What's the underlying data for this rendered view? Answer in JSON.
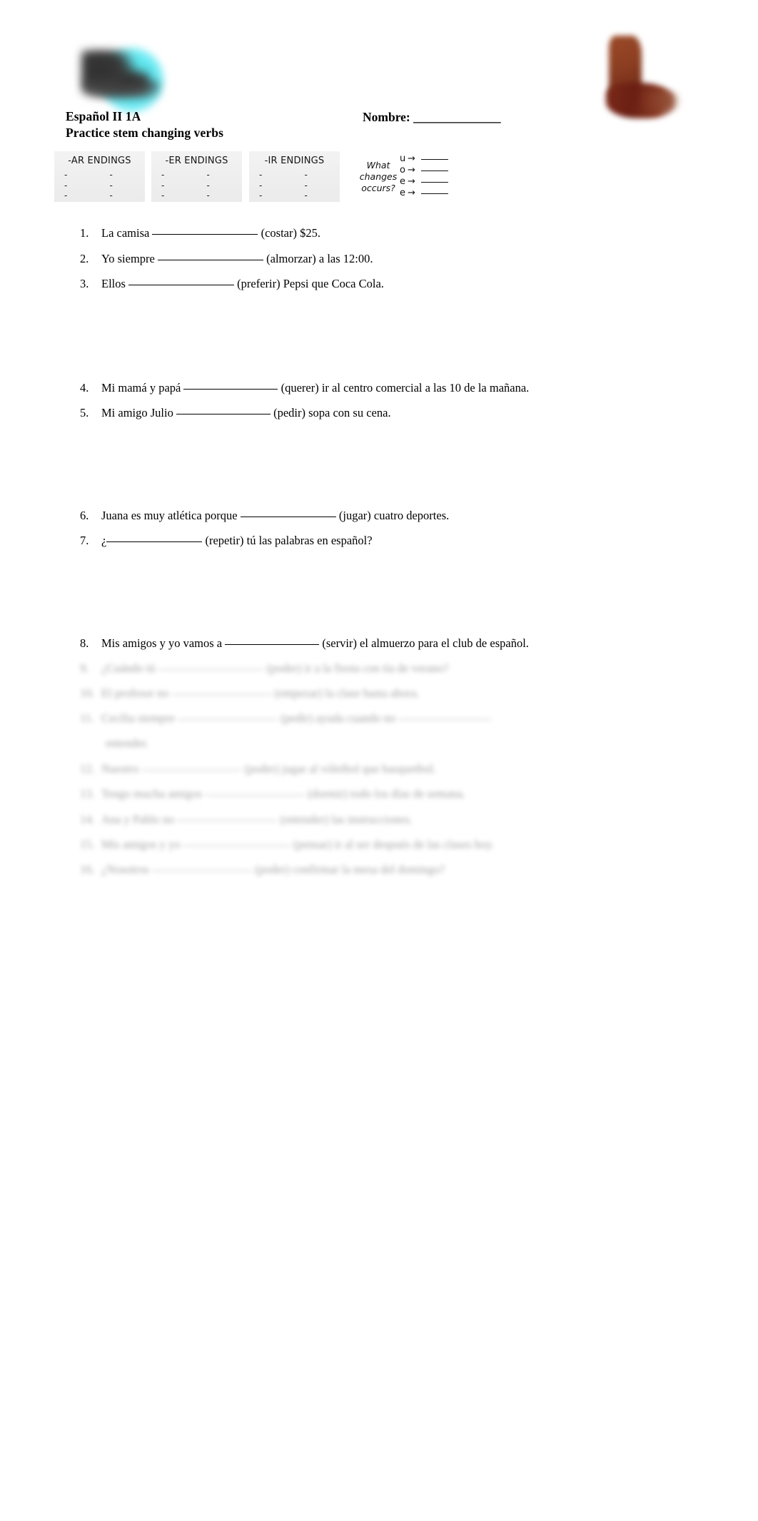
{
  "document": {
    "course_line": "Español II 1A",
    "subtitle_line": "Practice stem changing verbs",
    "name_label": "Nombre: ______________"
  },
  "images": {
    "left": "sneaker-image",
    "right": "cowboy-boot-image"
  },
  "ending_boxes": [
    {
      "title": "-AR ENDINGS",
      "col1": [
        "-",
        "-",
        "-"
      ],
      "col2": [
        "-",
        "-",
        "-"
      ]
    },
    {
      "title": "-ER ENDINGS",
      "col1": [
        "-",
        "-",
        "-"
      ],
      "col2": [
        "-",
        "-",
        "-"
      ]
    },
    {
      "title": "-IR ENDINGS",
      "col1": [
        "-",
        "-",
        "-"
      ],
      "col2": [
        "-",
        "-",
        "-"
      ]
    }
  ],
  "changes": {
    "prompt": "What changes occurs?",
    "prompt_lines": [
      "What",
      "changes",
      "occurs?"
    ],
    "rows": [
      {
        "letter": "u",
        "arrow": "→",
        "answer": ""
      },
      {
        "letter": "o",
        "arrow": "→",
        "answer": ""
      },
      {
        "letter": "e",
        "arrow": "→",
        "answer": ""
      },
      {
        "letter": "e",
        "arrow": "→",
        "answer": ""
      }
    ]
  },
  "questions": [
    {
      "num": "1.",
      "before": "La camisa ",
      "after": " (costar) $25.",
      "blank_width": 148
    },
    {
      "num": "2.",
      "before": "Yo siempre ",
      "after": " (almorzar) a las 12:00.",
      "blank_width": 148
    },
    {
      "num": "3.",
      "before": "Ellos ",
      "after": " (preferir) Pepsi que Coca Cola.",
      "blank_width": 148
    },
    {
      "num": "4.",
      "before": "Mi mamá y papá ",
      "after": " (querer) ir al centro comercial a las 10 de la mañana.",
      "blank_width": 132
    },
    {
      "num": "5.",
      "before": "Mi amigo Julio ",
      "after": " (pedir) sopa con su cena.",
      "blank_width": 132
    },
    {
      "num": "6.",
      "before": "Juana es muy atlética porque ",
      "after": " (jugar) cuatro deportes.",
      "blank_width": 134
    },
    {
      "num": "7.",
      "before": "¿",
      "after": " (repetir) tú las palabras en español?",
      "blank_width": 134
    },
    {
      "num": "8.",
      "before": "Mis amigos y yo vamos a ",
      "after": " (servir) el almuerzo para el club de español.",
      "blank_width": 132
    }
  ],
  "blurred_questions": [
    {
      "num": "9.",
      "before": "¿Cuándo tú ",
      "after": " (poder) ir a la fiesta con tía de verano?",
      "blank_width": 148
    },
    {
      "num": "10.",
      "before": "El profesor no ",
      "after": " (empezar) la clase hasta ahora.",
      "blank_width": 140
    },
    {
      "num": "11.",
      "before": "Cecilia siempre ",
      "after": " (pedir) ayuda cuando no ",
      "blank_width": 140,
      "after_blank_width": 130,
      "continuation": "entender."
    },
    {
      "num": "12.",
      "before": "Nuestro ",
      "after": " (poder) jugar al vóleibol que basquetbol.",
      "blank_width": 140
    },
    {
      "num": "13.",
      "before": "Tengo mucha amigos ",
      "after": " (dormir) todo los días de semana.",
      "blank_width": 140
    },
    {
      "num": "14.",
      "before": "Ana y Pablo no ",
      "after": " (entender) las instrucciones.",
      "blank_width": 140
    },
    {
      "num": "15.",
      "before": "Mis amigos y yo ",
      "after": " (pensar) ir al ser después de las clases hoy.",
      "blank_width": 150
    },
    {
      "num": "16.",
      "before": "¿Nosotros ",
      "after": " (poder) confirmar la mesa del domingo?",
      "blank_width": 140
    }
  ]
}
